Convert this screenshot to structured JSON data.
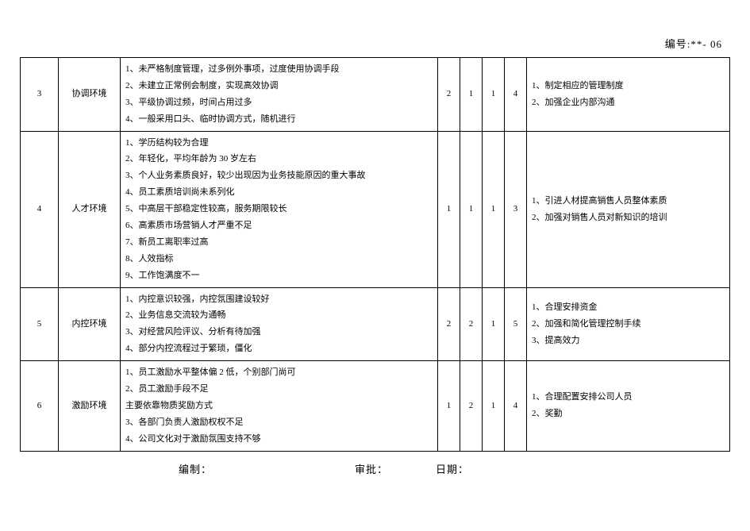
{
  "doc_number": "编号:**- 06",
  "rows": [
    {
      "index": "3",
      "category": "协调环境",
      "descriptions": [
        "1、未严格制度管理，过多例外事项，过度使用协调手段",
        "2、未建立正常例会制度，实现高效协调",
        "3、平级协调过频，时间占用过多",
        "4、一般采用口头、临时协调方式，随机进行"
      ],
      "n1": "2",
      "n2": "1",
      "n3": "1",
      "n4": "4",
      "measures": [
        "1、制定相应的管理制度",
        "2、加强企业内部沟通"
      ]
    },
    {
      "index": "4",
      "category": "人才环境",
      "descriptions": [
        "1、学历结构较为合理",
        "2、年轻化，平均年龄为 30 岁左右",
        "3、个人业务素质良好，较少出现因为业务技能原因的重大事故",
        "4、员工素质培训尚未系列化",
        "5、中高层干部稳定性较高，服务期限较长",
        "6、高素质市场营销人才严重不足",
        "7、新员工离职率过高",
        "8、人效指标",
        "9、工作饱满度不一"
      ],
      "n1": "1",
      "n2": "1",
      "n3": "1",
      "n4": "3",
      "measures": [
        "1、引进人材提高销售人员整体素质",
        "2、加强对销售人员对新知识的培训"
      ]
    },
    {
      "index": "5",
      "category": "内控环境",
      "descriptions": [
        "1、内控意识较强，内控氛围建设较好",
        "2、业务信息交流较为通畅",
        "3、对经营风险评议、分析有待加强",
        "4、部分内控流程过于繁琐，僵化"
      ],
      "n1": "2",
      "n2": "2",
      "n3": "1",
      "n4": "5",
      "measures": [
        "1、合理安排资金",
        "2、加强和简化管理控制手续",
        "3、提高效力"
      ]
    },
    {
      "index": "6",
      "category": "激励环境",
      "descriptions": [
        "1、员工激励水平整体偏 2 低，个别部门尚可",
        "2、员工激励手段不足",
        "主要依靠物质奖励方式",
        "3、各部门负责人激励权权不足",
        "4、公司文化对于激励氛围支持不够"
      ],
      "n1": "1",
      "n2": "2",
      "n3": "1",
      "n4": "4",
      "measures": [
        "1、合理配置安排公司人员",
        "2、奖勤"
      ]
    }
  ],
  "footer": {
    "prepared": "编制：",
    "approved": "审批：",
    "date": "日期："
  }
}
